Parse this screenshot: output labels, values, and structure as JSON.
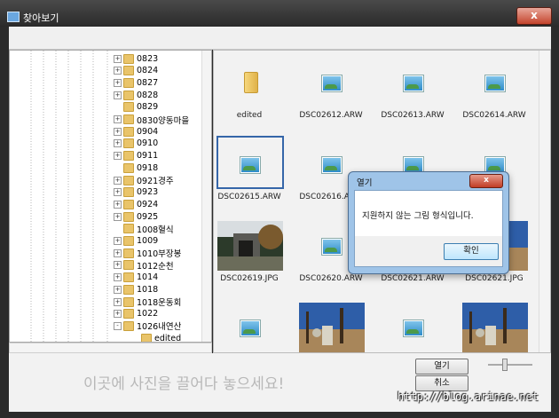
{
  "window": {
    "title": "찾아보기",
    "close_label": "x"
  },
  "tree": {
    "items": [
      {
        "label": "0823",
        "expander": "+"
      },
      {
        "label": "0824",
        "expander": "+"
      },
      {
        "label": "0827",
        "expander": "+"
      },
      {
        "label": "0828",
        "expander": "+"
      },
      {
        "label": "0829",
        "expander": ""
      },
      {
        "label": "0830양동마을",
        "expander": "+"
      },
      {
        "label": "0904",
        "expander": "+"
      },
      {
        "label": "0910",
        "expander": "+"
      },
      {
        "label": "0911",
        "expander": "+"
      },
      {
        "label": "0918",
        "expander": ""
      },
      {
        "label": "0921경주",
        "expander": "+"
      },
      {
        "label": "0923",
        "expander": "+"
      },
      {
        "label": "0924",
        "expander": "+"
      },
      {
        "label": "0925",
        "expander": "+"
      },
      {
        "label": "1008혈식",
        "expander": ""
      },
      {
        "label": "1009",
        "expander": "+"
      },
      {
        "label": "1010부장봉",
        "expander": "+"
      },
      {
        "label": "1012순천",
        "expander": "+"
      },
      {
        "label": "1014",
        "expander": "+"
      },
      {
        "label": "1018",
        "expander": "+"
      },
      {
        "label": "1018운동회",
        "expander": "+"
      },
      {
        "label": "1022",
        "expander": "+"
      },
      {
        "label": "1026내연산",
        "expander": "-"
      },
      {
        "label": "edited",
        "expander": "",
        "child": true
      }
    ]
  },
  "thumbnails": [
    {
      "caption": "edited",
      "kind": "folder"
    },
    {
      "caption": "DSC02612.ARW",
      "kind": "icon"
    },
    {
      "caption": "DSC02613.ARW",
      "kind": "icon"
    },
    {
      "caption": "DSC02614.ARW",
      "kind": "icon"
    },
    {
      "caption": "DSC02615.ARW",
      "kind": "icon",
      "selected": true
    },
    {
      "caption": "DSC02616.ARW",
      "kind": "icon"
    },
    {
      "caption": "",
      "kind": "icon"
    },
    {
      "caption": "",
      "kind": "icon"
    },
    {
      "caption": "DSC02619.JPG",
      "kind": "photo"
    },
    {
      "caption": "DSC02620.ARW",
      "kind": "icon"
    },
    {
      "caption": "DSC02621.ARW",
      "kind": "icon"
    },
    {
      "caption": "DSC02621.JPG",
      "kind": "photo"
    },
    {
      "caption": "",
      "kind": "icon"
    },
    {
      "caption": "",
      "kind": "photo"
    },
    {
      "caption": "",
      "kind": "icon"
    },
    {
      "caption": "",
      "kind": "photo"
    }
  ],
  "bottom": {
    "drop_hint": "이곳에 사진을 끌어다 놓으세요!",
    "open_label": "열기",
    "cancel_label": "취소"
  },
  "dialog": {
    "title": "열기",
    "close_label": "x",
    "message": "지원하지 않는 그림 형식입니다.",
    "ok_label": "확인"
  },
  "watermark": "http://blog.arinae.net"
}
